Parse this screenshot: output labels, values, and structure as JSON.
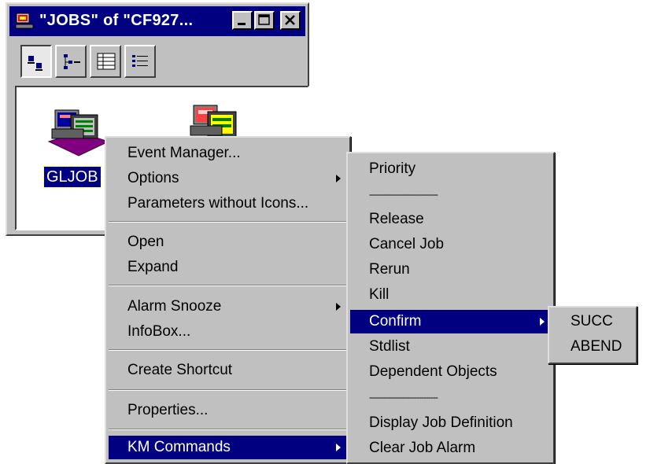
{
  "window": {
    "title": "\"JOBS\" of \"CF927...",
    "controls": {
      "minimize": "minimize",
      "maximize": "maximize",
      "close": "close"
    },
    "toolbar": [
      "large-icons-view",
      "small-icons-view",
      "list-view",
      "details-view"
    ],
    "jobs": [
      {
        "label": "GLJOB",
        "selected": true
      }
    ]
  },
  "context_menu": {
    "items": [
      {
        "label": "Event Manager...",
        "submenu": false
      },
      {
        "label": "Options",
        "submenu": true
      },
      {
        "label": "Parameters without Icons...",
        "submenu": false
      },
      {
        "label": "Open",
        "submenu": false
      },
      {
        "label": "Expand",
        "submenu": false
      },
      {
        "label": "Alarm Snooze",
        "submenu": true
      },
      {
        "label": "InfoBox...",
        "submenu": false
      },
      {
        "label": "Create Shortcut",
        "submenu": false
      },
      {
        "label": "Properties...",
        "submenu": false
      },
      {
        "label": "KM Commands",
        "submenu": true,
        "highlighted": true
      }
    ]
  },
  "km_commands_menu": {
    "items": [
      {
        "label": "Priority"
      },
      {
        "label": "Release"
      },
      {
        "label": "Cancel Job"
      },
      {
        "label": "Rerun"
      },
      {
        "label": "Kill"
      },
      {
        "label": "Confirm",
        "submenu": true,
        "highlighted": true
      },
      {
        "label": "Stdlist"
      },
      {
        "label": "Dependent Objects"
      },
      {
        "label": "Display Job Definition"
      },
      {
        "label": "Clear Job Alarm"
      }
    ],
    "dash_separator": "-----------------------------"
  },
  "confirm_menu": {
    "items": [
      {
        "label": "SUCC"
      },
      {
        "label": "ABEND"
      }
    ]
  },
  "colors": {
    "face": "#c0c0c0",
    "highlight": "#000080",
    "titlebar": "#000080"
  }
}
